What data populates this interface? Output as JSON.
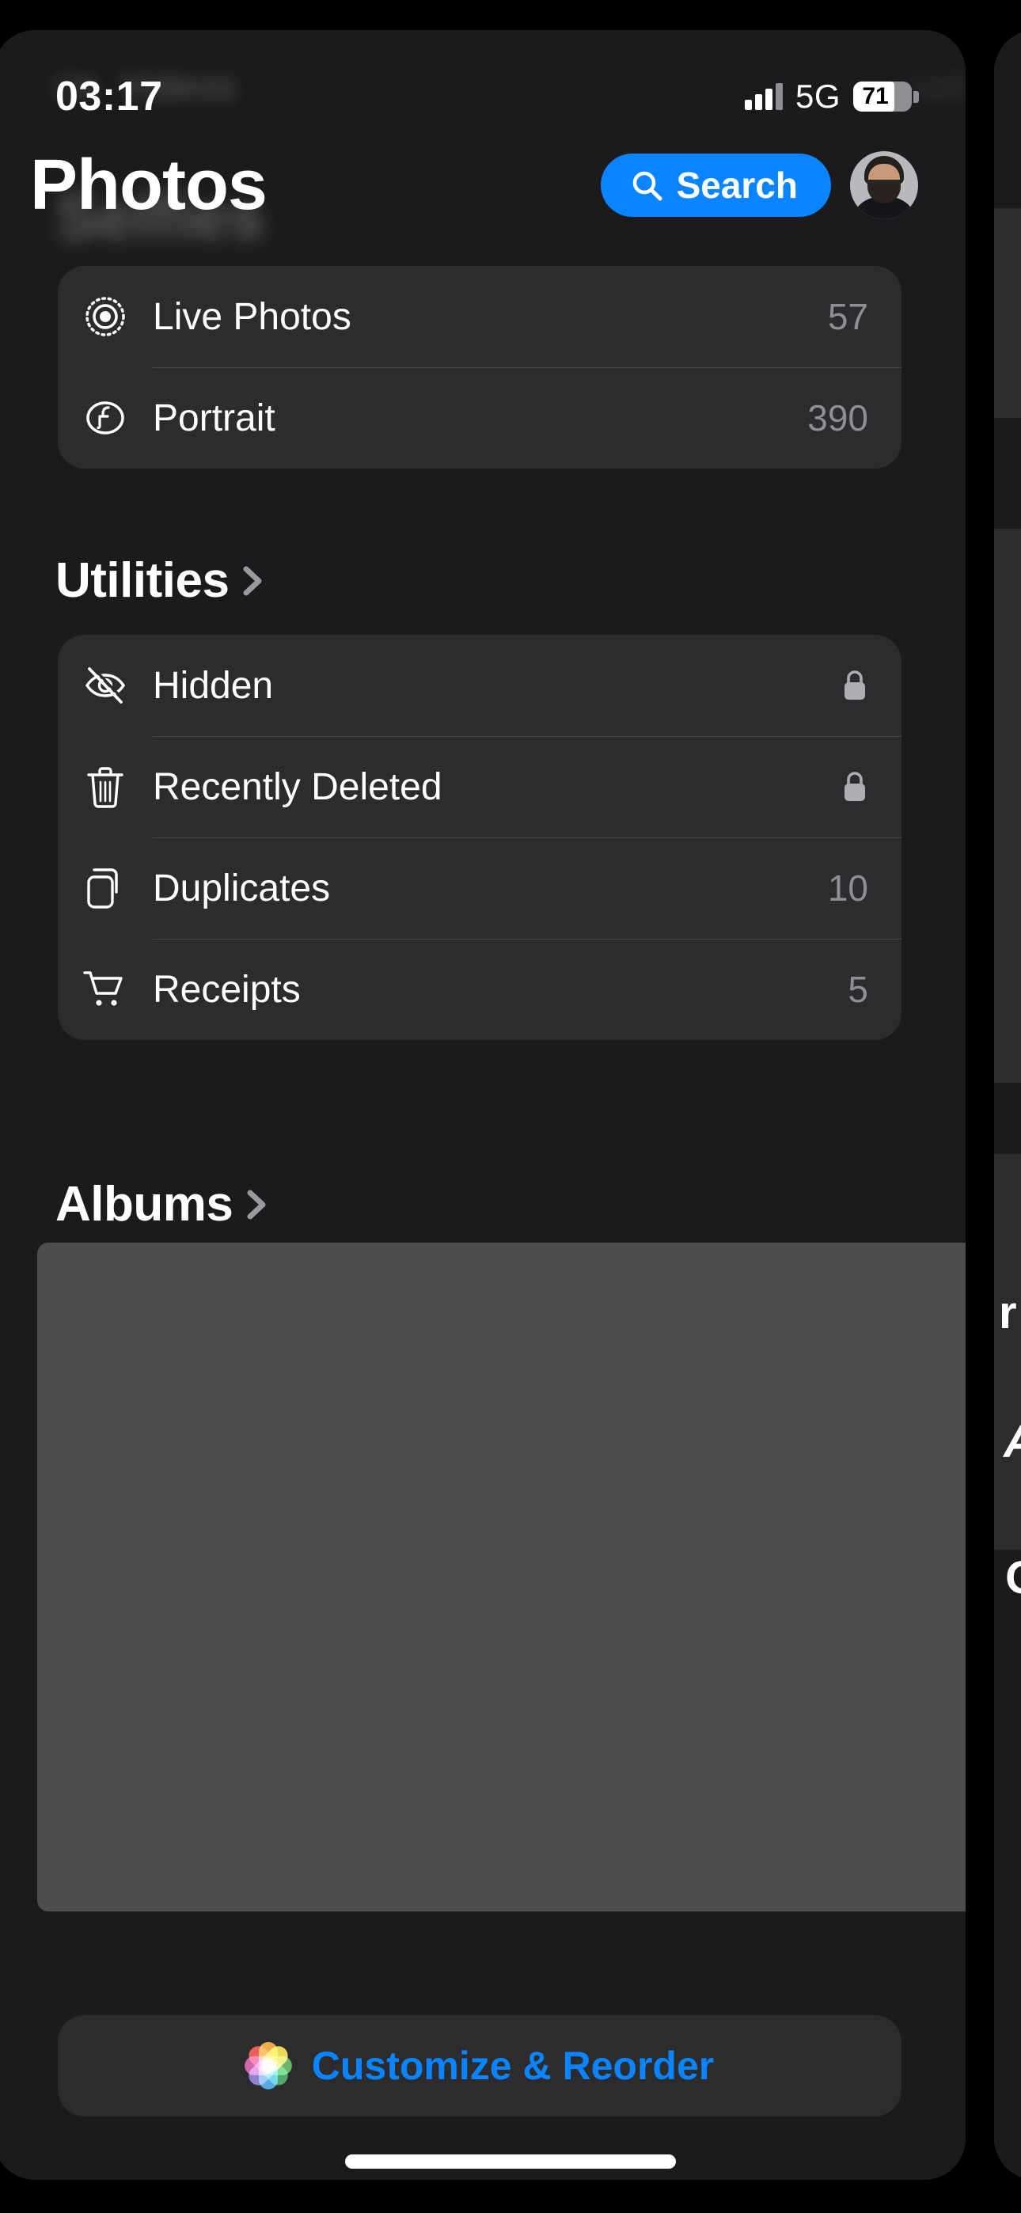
{
  "status_bar": {
    "time": "03:17",
    "network": "5G",
    "battery_level": "71",
    "signal_icon": "cellular-bars-icon",
    "battery_icon": "battery-icon"
  },
  "header": {
    "title": "Photos",
    "search_label": "Search",
    "search_icon": "search-icon",
    "avatar": "account-avatar"
  },
  "background_blurred_row": {
    "label": "Videos",
    "count": "116",
    "icon": "video-icon",
    "title_behind": "Selfies"
  },
  "media_types": {
    "rows": [
      {
        "icon": "live-photo-icon",
        "label": "Live Photos",
        "count": "57"
      },
      {
        "icon": "portrait-aperture-icon",
        "label": "Portrait",
        "count": "390"
      }
    ]
  },
  "utilities": {
    "header": "Utilities",
    "chevron_icon": "chevron-right-icon",
    "rows": [
      {
        "icon": "eye-slash-icon",
        "label": "Hidden",
        "count": "",
        "locked": true,
        "lock_icon": "lock-icon"
      },
      {
        "icon": "trash-icon",
        "label": "Recently Deleted",
        "count": "",
        "locked": true,
        "lock_icon": "lock-icon"
      },
      {
        "icon": "duplicates-icon",
        "label": "Duplicates",
        "count": "10",
        "locked": false,
        "lock_icon": ""
      },
      {
        "icon": "shopping-cart-icon",
        "label": "Receipts",
        "count": "5",
        "locked": false,
        "lock_icon": ""
      }
    ]
  },
  "albums": {
    "header": "Albums",
    "chevron_icon": "chevron-right-icon"
  },
  "footer": {
    "customize_label": "Customize & Reorder",
    "photos_logo_icon": "photos-flower-icon"
  },
  "home_indicator": "home-indicator",
  "colors": {
    "accent_blue": "#0a84ff",
    "card_background": "#2c2c2e",
    "page_background": "#1b1b1d",
    "secondary_text": "#8e8e93",
    "overlay_gray": "#4d4d4d"
  },
  "peek_panel": {
    "fragment_1": "r",
    "fragment_2": "A",
    "fragment_3": "O"
  }
}
